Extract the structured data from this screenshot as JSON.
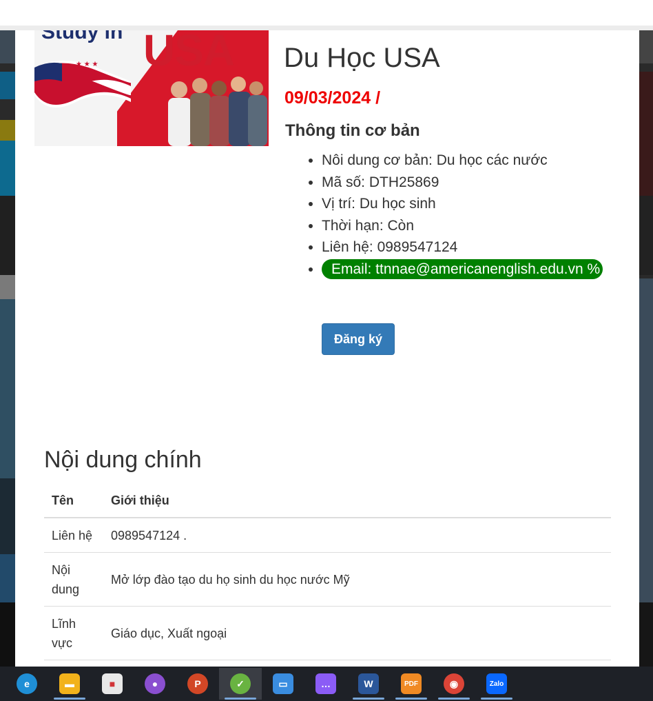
{
  "modal": {
    "hero_image": {
      "alt": "Study in USA",
      "line1": "Study in",
      "line2": "USA"
    },
    "title": "Du Học USA",
    "date": "09/03/2024 /",
    "basic_info_heading": "Thông tin cơ bản",
    "info_items": [
      "Nôi dung cơ bản: Du học các nước",
      "Mã số: DTH25869",
      "Vị trí: Du học sinh",
      "Thời hạn: Còn",
      "Liên hệ: 0989547124"
    ],
    "email_label": "Email: ttnnae@americanenglish.edu.vn %",
    "register_button": "Đăng ký",
    "main_content_heading": "Nội dung chính",
    "table": {
      "headers": [
        "Tên",
        "Giới thiệu"
      ],
      "rows": [
        {
          "name": "Liên hệ",
          "value": "0989547124 ."
        },
        {
          "name": "Nội dung",
          "value": "Mở lớp đào tạo du họ sinh du học nước Mỹ"
        },
        {
          "name": "Lĩnh vực",
          "value": "Giáo dục, Xuất ngoại"
        }
      ]
    }
  },
  "taskbar": {
    "icons": [
      {
        "name": "edge-icon",
        "color": "#1f8fd6",
        "glyph": "e"
      },
      {
        "name": "file-explorer-icon",
        "color": "#f2b21b",
        "glyph": "▬"
      },
      {
        "name": "microsoft-store-icon",
        "color": "#e8e8e8",
        "glyph": "■"
      },
      {
        "name": "github-desktop-icon",
        "color": "#8a4fd0",
        "glyph": "●"
      },
      {
        "name": "powerpoint-icon",
        "color": "#d24726",
        "glyph": "P"
      },
      {
        "name": "coccoc-browser-icon",
        "color": "#69b341",
        "glyph": "✓"
      },
      {
        "name": "remote-desktop-icon",
        "color": "#3a8de0",
        "glyph": "▭"
      },
      {
        "name": "chat-app-icon",
        "color": "#8b5cf6",
        "glyph": "…"
      },
      {
        "name": "word-icon",
        "color": "#2b579a",
        "glyph": "W"
      },
      {
        "name": "pdf-reader-icon",
        "color": "#f08a24",
        "glyph": "PDF"
      },
      {
        "name": "chrome-icon",
        "color": "#db4437",
        "glyph": "◉"
      },
      {
        "name": "zalo-icon",
        "color": "#0a68ff",
        "glyph": "Zalo"
      }
    ],
    "active_index": 5
  }
}
